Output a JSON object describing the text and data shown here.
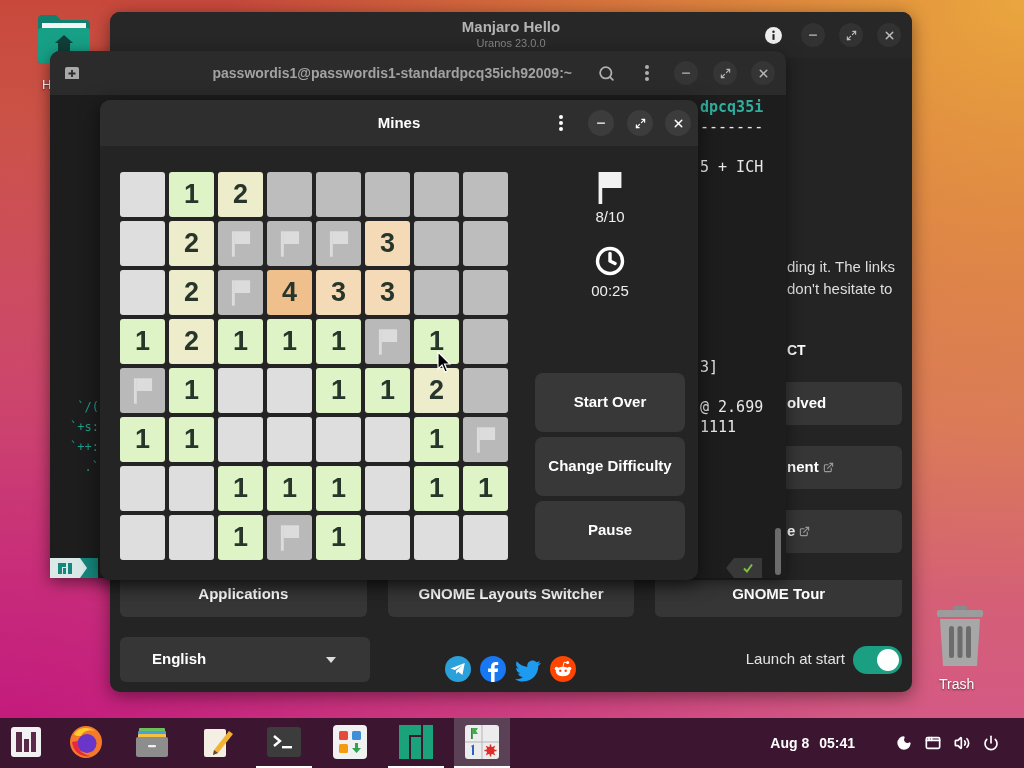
{
  "desktop_icons": [
    {
      "kind": "home",
      "label": "H"
    },
    {
      "kind": "trash",
      "label": "Trash"
    }
  ],
  "hello_window": {
    "title": "Manjaro Hello",
    "subtitle": "Uranos 23.0.0",
    "text_lines": [
      "ding it. The links",
      "don't hesitate to"
    ],
    "heading": "CT",
    "link_buttons": [
      {
        "label": "olved",
        "external": false
      },
      {
        "label": "nent",
        "external": true
      },
      {
        "label": "e",
        "external": true
      }
    ],
    "bottom_buttons": [
      "Applications",
      "GNOME Layouts Switcher",
      "GNOME Tour"
    ],
    "language": {
      "value": "English"
    },
    "social_links": [
      {
        "kind": "telegram"
      },
      {
        "kind": "facebook"
      },
      {
        "kind": "twitter"
      },
      {
        "kind": "reddit"
      }
    ],
    "launch_at_start": {
      "label": "Launch at start",
      "on": true
    }
  },
  "terminal": {
    "title": "passwordis1@passwordis1-standardpcq35ich92009:~",
    "lines": [
      {
        "kind": "text",
        "info": "dpcq35i",
        "highlight": true
      },
      {
        "kind": "text",
        "info": "-------",
        "highlight": false
      },
      {
        "kind": "blank"
      },
      {
        "kind": "text",
        "info": "5 + ICH",
        "highlight": false
      },
      {
        "kind": "blank"
      },
      {
        "kind": "blank"
      },
      {
        "kind": "blank"
      },
      {
        "kind": "blank"
      },
      {
        "kind": "blank"
      },
      {
        "kind": "blank"
      },
      {
        "kind": "blank"
      },
      {
        "kind": "blank"
      },
      {
        "kind": "blank"
      },
      {
        "kind": "text",
        "info": "3]",
        "highlight": false
      },
      {
        "kind": "blank"
      },
      {
        "kind": "text",
        "logo": "`/(",
        "info": "@ 2.699",
        "highlight": false
      },
      {
        "kind": "text",
        "logo": "`+s:",
        "info": "1111",
        "highlight": false
      },
      {
        "kind": "text",
        "logo": "`++:"
      },
      {
        "kind": "text",
        "logo": ".`"
      }
    ]
  },
  "mines": {
    "title": "Mines",
    "board": [
      [
        {
          "kind": "empty"
        },
        {
          "kind": "number",
          "text": "1",
          "color": "#dff4c6"
        },
        {
          "kind": "number",
          "text": "2",
          "color": "#eeedcb"
        },
        {
          "kind": "hidden"
        },
        {
          "kind": "hidden"
        },
        {
          "kind": "hidden"
        },
        {
          "kind": "hidden"
        },
        {
          "kind": "hidden"
        }
      ],
      [
        {
          "kind": "empty"
        },
        {
          "kind": "number",
          "text": "2",
          "color": "#eeedcb"
        },
        {
          "kind": "flag"
        },
        {
          "kind": "flag"
        },
        {
          "kind": "flag"
        },
        {
          "kind": "number",
          "text": "3",
          "color": "#f4dab6"
        },
        {
          "kind": "hidden"
        },
        {
          "kind": "hidden"
        }
      ],
      [
        {
          "kind": "empty"
        },
        {
          "kind": "number",
          "text": "2",
          "color": "#eeedcb"
        },
        {
          "kind": "flag"
        },
        {
          "kind": "number",
          "text": "4",
          "color": "#efc08c"
        },
        {
          "kind": "number",
          "text": "3",
          "color": "#f4dab6"
        },
        {
          "kind": "number",
          "text": "3",
          "color": "#f4dab6"
        },
        {
          "kind": "hidden"
        },
        {
          "kind": "hidden"
        }
      ],
      [
        {
          "kind": "number",
          "text": "1",
          "color": "#dff4c6"
        },
        {
          "kind": "number",
          "text": "2",
          "color": "#eeedcb"
        },
        {
          "kind": "number",
          "text": "1",
          "color": "#dff4c6"
        },
        {
          "kind": "number",
          "text": "1",
          "color": "#dff4c6"
        },
        {
          "kind": "number",
          "text": "1",
          "color": "#dff4c6"
        },
        {
          "kind": "flag"
        },
        {
          "kind": "number",
          "text": "1",
          "color": "#dff4c6"
        },
        {
          "kind": "hidden"
        }
      ],
      [
        {
          "kind": "flag"
        },
        {
          "kind": "number",
          "text": "1",
          "color": "#dff4c6"
        },
        {
          "kind": "empty"
        },
        {
          "kind": "empty"
        },
        {
          "kind": "number",
          "text": "1",
          "color": "#dff4c6"
        },
        {
          "kind": "number",
          "text": "1",
          "color": "#dff4c6"
        },
        {
          "kind": "number",
          "text": "2",
          "color": "#eeedcb"
        },
        {
          "kind": "hidden"
        }
      ],
      [
        {
          "kind": "number",
          "text": "1",
          "color": "#dff4c6"
        },
        {
          "kind": "number",
          "text": "1",
          "color": "#dff4c6"
        },
        {
          "kind": "empty"
        },
        {
          "kind": "empty"
        },
        {
          "kind": "empty"
        },
        {
          "kind": "empty"
        },
        {
          "kind": "number",
          "text": "1",
          "color": "#dff4c6"
        },
        {
          "kind": "flag"
        }
      ],
      [
        {
          "kind": "empty"
        },
        {
          "kind": "empty"
        },
        {
          "kind": "number",
          "text": "1",
          "color": "#dff4c6"
        },
        {
          "kind": "number",
          "text": "1",
          "color": "#dff4c6"
        },
        {
          "kind": "number",
          "text": "1",
          "color": "#dff4c6"
        },
        {
          "kind": "empty"
        },
        {
          "kind": "number",
          "text": "1",
          "color": "#dff4c6"
        },
        {
          "kind": "number",
          "text": "1",
          "color": "#dff4c6"
        }
      ],
      [
        {
          "kind": "empty"
        },
        {
          "kind": "empty"
        },
        {
          "kind": "number",
          "text": "1",
          "color": "#dff4c6"
        },
        {
          "kind": "flag"
        },
        {
          "kind": "number",
          "text": "1",
          "color": "#dff4c6"
        },
        {
          "kind": "empty"
        },
        {
          "kind": "empty"
        },
        {
          "kind": "empty"
        }
      ]
    ],
    "flag_count": "8/10",
    "elapsed": "00:25",
    "buttons": [
      "Start Over",
      "Change Difficulty",
      "Pause"
    ]
  },
  "taskbar": {
    "apps": [
      {
        "kind": "menu",
        "running": false,
        "selected": false
      },
      {
        "kind": "browser",
        "running": false,
        "selected": false
      },
      {
        "kind": "files",
        "running": false,
        "selected": false
      },
      {
        "kind": "editor",
        "running": false,
        "selected": false
      },
      {
        "kind": "terminal",
        "running": true,
        "selected": false
      },
      {
        "kind": "software",
        "running": false,
        "selected": false
      },
      {
        "kind": "hello",
        "running": true,
        "selected": false
      },
      {
        "kind": "mines",
        "running": true,
        "selected": true
      }
    ],
    "date": "Aug 8",
    "time": "05:41"
  }
}
